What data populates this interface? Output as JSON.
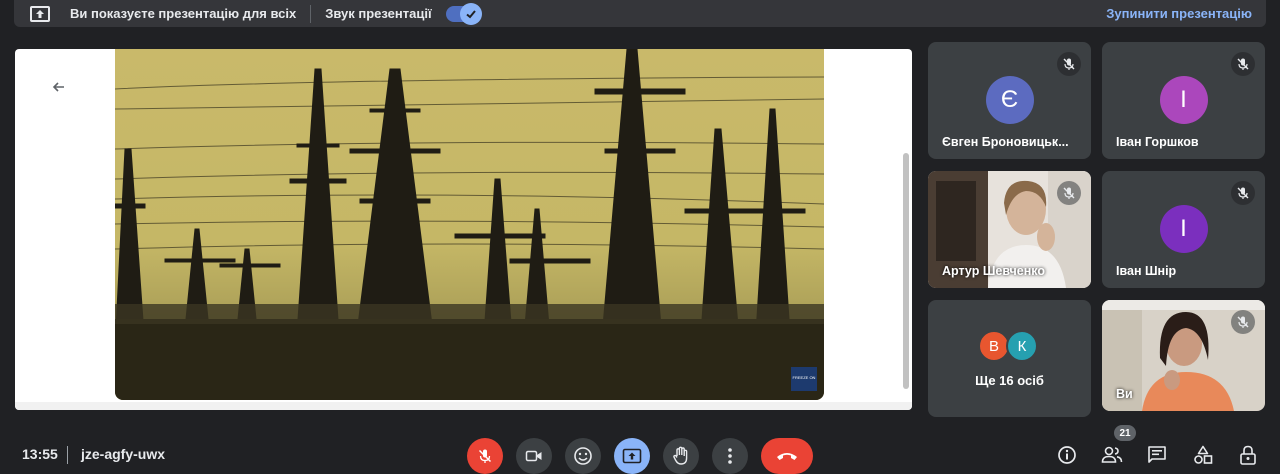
{
  "banner": {
    "message": "Ви показуєте презентацію для всіх",
    "audio_label": "Звук презентації",
    "audio_enabled": true,
    "stop_label": "Зупинити презентацію",
    "accent_color": "#8ab4f8"
  },
  "presentation": {
    "back_icon": "arrow-left-icon",
    "watermark": "FREEZE ON"
  },
  "participants": [
    {
      "name": "Євген Броновицьк...",
      "initial": "Є",
      "avatar_color": "#5c6bc0",
      "muted": true,
      "has_video": false
    },
    {
      "name": "Іван Горшков",
      "initial": "І",
      "avatar_color": "#ab47bc",
      "muted": true,
      "has_video": false
    },
    {
      "name": "Артур Шевченко",
      "muted": true,
      "has_video": true
    },
    {
      "name": "Іван Шнір",
      "initial": "І",
      "avatar_color": "#7b2fbe",
      "muted": true,
      "has_video": false
    },
    {
      "name": "Ви",
      "muted": true,
      "has_video": true
    }
  ],
  "others": {
    "label": "Ще 16 осіб",
    "avatars": [
      {
        "initial": "В",
        "color": "#e8562f"
      },
      {
        "initial": "К",
        "color": "#26a0b0"
      }
    ]
  },
  "bottom": {
    "time": "13:55",
    "meeting_code": "jze-agfy-uwx",
    "participant_count": "21",
    "controls": [
      "mic-off-icon",
      "camera-icon",
      "emoji-icon",
      "present-icon",
      "raise-hand-icon",
      "more-options-icon",
      "end-call-icon"
    ],
    "right_icons": [
      "info-icon",
      "people-icon",
      "chat-icon",
      "activities-icon",
      "host-controls-icon"
    ],
    "end_call_color": "#ea4335"
  }
}
